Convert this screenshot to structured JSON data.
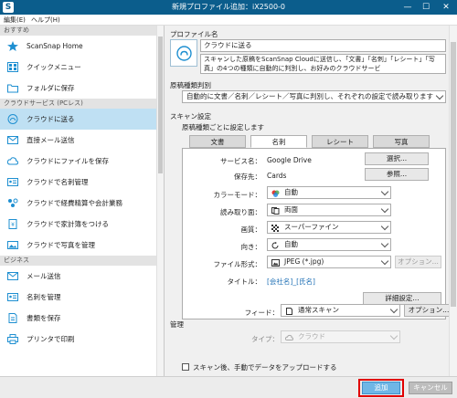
{
  "window": {
    "title": "新規プロファイル追加：iX2500-0",
    "minimize": "—",
    "maximize": "☐",
    "close": "✕"
  },
  "menu": {
    "edit": "編集(E)",
    "help": "ヘルプ(H)"
  },
  "sidebar": {
    "sections": [
      {
        "label": "おすすめ",
        "items": [
          {
            "label": "ScanSnap Home",
            "icon": "star-icon"
          },
          {
            "label": "クイックメニュー",
            "icon": "quick-menu-icon"
          },
          {
            "label": "フォルダに保存",
            "icon": "folder-icon"
          }
        ]
      },
      {
        "label": "クラウドサービス (PCレス)",
        "items": [
          {
            "label": "クラウドに送る",
            "icon": "cloud-icon"
          },
          {
            "label": "直接メール送信",
            "icon": "mail-icon"
          },
          {
            "label": "クラウドにファイルを保存",
            "icon": "cloud-save-icon"
          },
          {
            "label": "クラウドで名刺管理",
            "icon": "business-card-icon"
          },
          {
            "label": "クラウドで経費精算や会計業務",
            "icon": "expense-icon"
          },
          {
            "label": "クラウドで家計簿をつける",
            "icon": "household-icon"
          },
          {
            "label": "クラウドで写真を管理",
            "icon": "photo-icon"
          }
        ]
      },
      {
        "label": "ビジネス",
        "items": [
          {
            "label": "メール送信",
            "icon": "mail-icon"
          },
          {
            "label": "名刺を管理",
            "icon": "card-icon"
          },
          {
            "label": "書類を保存",
            "icon": "document-icon"
          },
          {
            "label": "プリンタで印刷",
            "icon": "printer-icon"
          }
        ]
      }
    ],
    "selected": "クラウドに送る"
  },
  "profile": {
    "section_label": "プロファイル名",
    "name": "クラウドに送る",
    "description": "スキャンした原稿をScanSnap Cloudに送信し、「文書」「名刺」「レシート」「写真」の4つの種類に自動的に判別し、お好みのクラウドサービ"
  },
  "doc_type": {
    "label": "原稿種類判別",
    "value": "自動的に文書／名刺／レシート／写真に判別し、それぞれの設定で読み取ります"
  },
  "scan_settings": {
    "label": "スキャン設定",
    "per_type_label": "原稿種類ごとに設定します",
    "tabs": [
      "文書",
      "名刺",
      "レシート",
      "写真"
    ],
    "selected_tab": "名刺",
    "service_label": "サービス名：",
    "service_value": "Google Drive",
    "select_button": "選択...",
    "save_label": "保存先：",
    "save_value": "Cards",
    "browse_button": "参照...",
    "color_label": "カラーモード：",
    "color_value": "自動",
    "side_label": "読み取り面：",
    "side_value": "両面",
    "quality_label": "画質：",
    "quality_value": "スーパーファイン",
    "orientation_label": "向き：",
    "orientation_value": "自動",
    "format_label": "ファイル形式：",
    "format_value": "JPEG (*.jpg)",
    "option_button_disabled": "オプション...",
    "title_label": "タイトル：",
    "title_value": "[会社名]_[氏名]",
    "detail_button": "詳細設定..."
  },
  "feed": {
    "label": "フィード：",
    "value": "通常スキャン",
    "option_button": "オプション..."
  },
  "management": {
    "label": "管理",
    "type_label": "タイプ：",
    "type_value": "クラウド"
  },
  "upload_checkbox": "スキャン後、手動でデータをアップロードする",
  "footer": {
    "add_button": "追加",
    "cancel_button": "キャンセル"
  },
  "colors": {
    "titlebar": "#0b5d8c",
    "selected_item": "#bfe0f3",
    "accent": "#1e8fd1",
    "highlight_border": "#e00000"
  }
}
